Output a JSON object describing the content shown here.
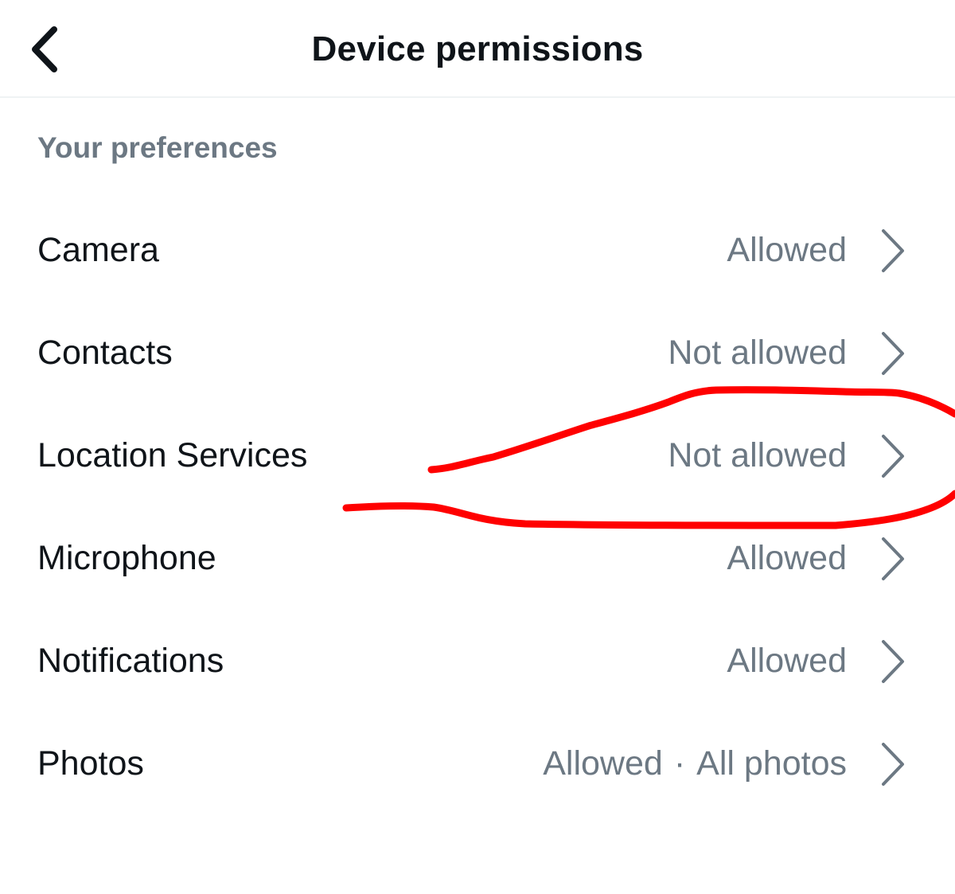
{
  "header": {
    "title": "Device permissions",
    "back_icon": "chevron-left-icon"
  },
  "section": {
    "heading": "Your preferences"
  },
  "permissions": [
    {
      "label": "Camera",
      "status": "Allowed",
      "detail": ""
    },
    {
      "label": "Contacts",
      "status": "Not allowed",
      "detail": ""
    },
    {
      "label": "Location Services",
      "status": "Not allowed",
      "detail": ""
    },
    {
      "label": "Microphone",
      "status": "Allowed",
      "detail": ""
    },
    {
      "label": "Notifications",
      "status": "Allowed",
      "detail": ""
    },
    {
      "label": "Photos",
      "status": "Allowed",
      "separator": "·",
      "detail": "All photos"
    }
  ],
  "annotation": {
    "color": "#ff0000",
    "description_icon": "hand-drawn-red-circle"
  },
  "colors": {
    "primary_text": "#0f1419",
    "secondary_text": "#6c7883",
    "divider": "#eff3f4"
  }
}
